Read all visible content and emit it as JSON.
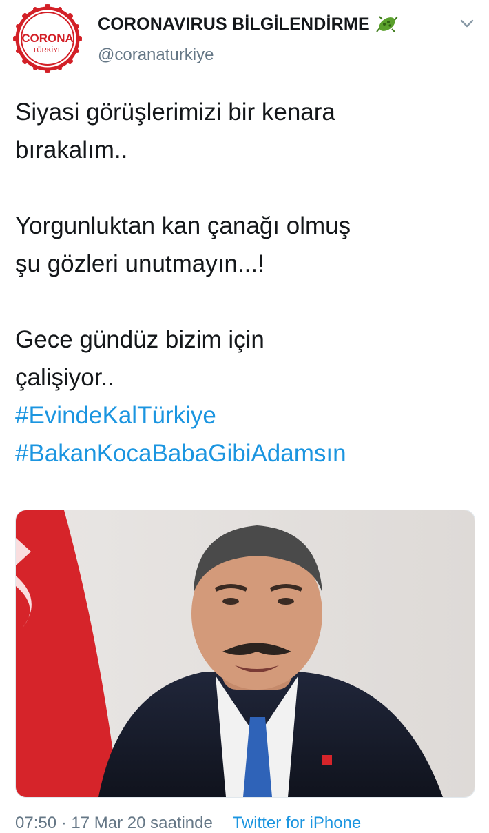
{
  "account": {
    "display_name": "CORONAVIRUS BİLGİLENDİRME",
    "handle": "@coranaturkiye",
    "avatar_text_top": "CORONA",
    "avatar_text_bottom": "TÜRKİYE",
    "name_emoji_icon": "virus-icon",
    "menu_icon": "chevron-down-icon"
  },
  "tweet": {
    "lines_block1": [
      "Siyasi görüşlerimizi bir kenara",
      "bırakalım.."
    ],
    "lines_block2": [
      "Yorgunluktan kan çanağı olmuş",
      "şu gözleri unutmayın...!"
    ],
    "lines_block3": [
      "Gece gündüz bizim için",
      "çalişiyor.."
    ],
    "hashtags": [
      "#EvindeKalTürkiye",
      "#BakanKocaBabaGibiAdamsın"
    ]
  },
  "meta": {
    "timestamp": "07:50 · 17 Mar 20 saatinde",
    "source": "Twitter for iPhone"
  },
  "colors": {
    "text": "#14171a",
    "secondary": "#657786",
    "link": "#1b95e0",
    "avatar_red": "#d32027",
    "virus_green": "#5aa02c"
  }
}
